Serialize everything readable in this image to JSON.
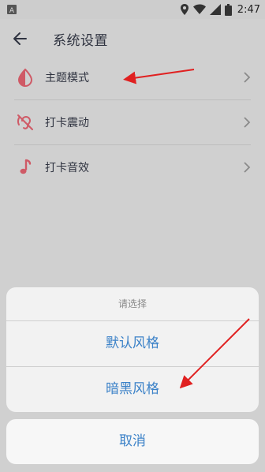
{
  "status_bar": {
    "time": "2:47"
  },
  "header": {
    "title": "系统设置"
  },
  "settings": [
    {
      "label": "主题模式",
      "icon": "drop-half-icon"
    },
    {
      "label": "打卡震动",
      "icon": "vibration-off-icon"
    },
    {
      "label": "打卡音效",
      "icon": "music-note-icon"
    }
  ],
  "action_sheet": {
    "title": "请选择",
    "options": [
      "默认风格",
      "暗黑风格"
    ],
    "cancel": "取消"
  },
  "colors": {
    "accent_blue": "#3c82c8",
    "icon_red": "#cf5a66",
    "annotation_red": "#e02020"
  }
}
